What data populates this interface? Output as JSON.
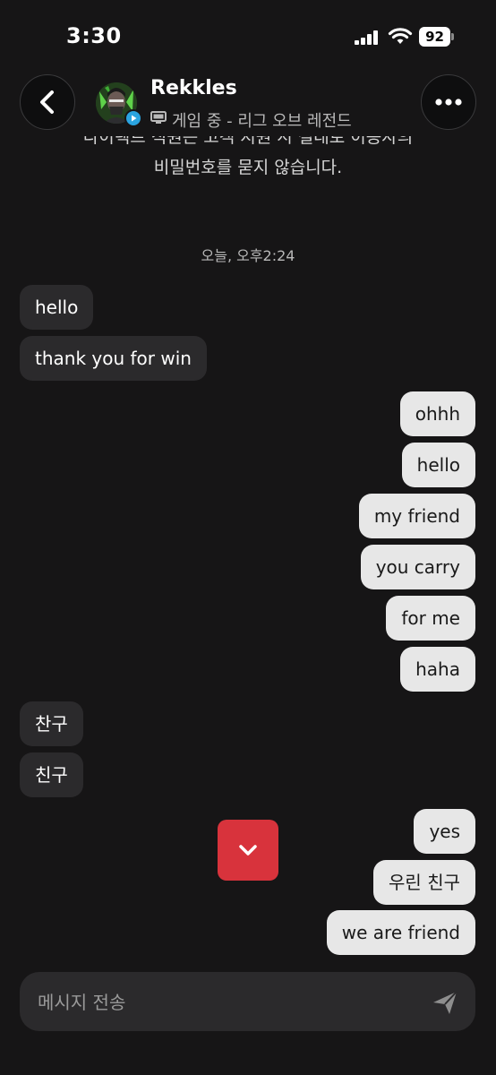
{
  "status_bar": {
    "time": "3:30",
    "battery": "92"
  },
  "header": {
    "contact_name": "Rekkles",
    "status": "게임 중 - 리그 오브 레전드"
  },
  "notice": {
    "line1": "다이렉트 직원은 고객 지원 시 절대로 이용자의",
    "line2": "비밀번호를 묻지 않습니다."
  },
  "date_separator": "오늘, 오후2:24",
  "messages": [
    {
      "side": "in",
      "text": "hello"
    },
    {
      "side": "in",
      "text": "thank you for win"
    },
    {
      "side": "out",
      "text": "ohhh"
    },
    {
      "side": "out",
      "text": "hello"
    },
    {
      "side": "out",
      "text": "my friend"
    },
    {
      "side": "out",
      "text": "you carry"
    },
    {
      "side": "out",
      "text": "for me"
    },
    {
      "side": "out",
      "text": "haha"
    },
    {
      "side": "in",
      "text": "찬구"
    },
    {
      "side": "in",
      "text": "친구"
    },
    {
      "side": "out",
      "text": "yes"
    },
    {
      "side": "out",
      "text": "우린 친구"
    },
    {
      "side": "out",
      "text": "we are friend"
    }
  ],
  "composer": {
    "placeholder": "메시지 전송"
  },
  "icons": {
    "back": "chevron-left-icon",
    "more": "more-dots-icon",
    "scroll_down": "chevron-down-icon",
    "send": "send-icon",
    "status": "monitor-icon"
  },
  "colors": {
    "background": "#161516",
    "incoming_bubble": "#2b2a2c",
    "outgoing_bubble": "#e7e7e7",
    "scroll_button": "#d8333c",
    "badge": "#2aa4e0"
  }
}
